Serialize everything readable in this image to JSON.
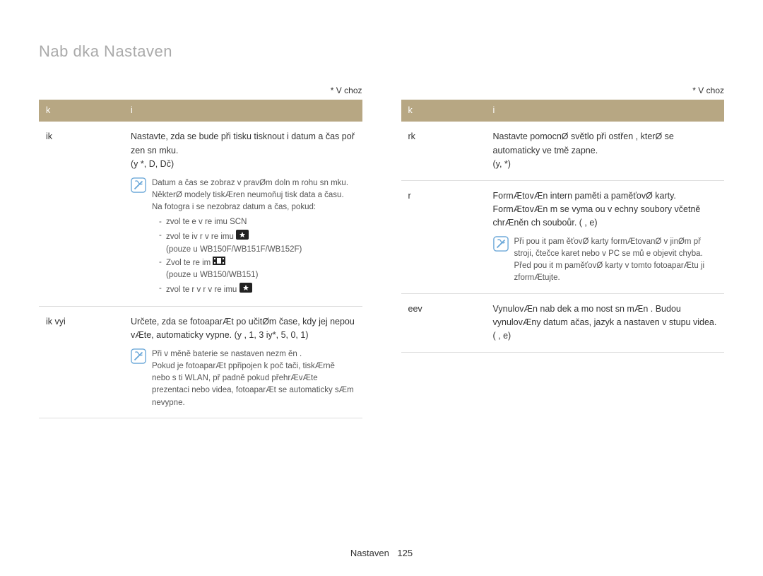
{
  "title": "Nab dka Nastaven",
  "default_marker": "* V choz",
  "footer": {
    "label": "Nastaven",
    "page": "125"
  },
  "icons": {
    "note_alt": "note-icon"
  },
  "left": {
    "header": {
      "k": "k",
      "i": "i"
    },
    "rows": [
      {
        "key": "ik",
        "desc_lines": [
          "Nastavte, zda se bude při tisku tisknout i datum a čas poř zen  sn mku.",
          "(y          *, D, Dč)"
        ],
        "note_lines": [
          "Datum a čas se zobraz  v pravØm doln m rohu sn mku.",
          "NěkterØ modely tiskÆren neumoňuj  tisk data a času.",
          "Na fotogra i se nezobraz  datum a čas, pokud:"
        ],
        "note_bullets": [
          {
            "text": "zvol te e       v re imu SCN",
            "glyph": null
          },
          {
            "text": "zvol te iv r  v re imu",
            "glyph": "star-camera",
            "sub": "(pouze u WB150F/WB151F/WB152F)"
          },
          {
            "text": "Zvol te re im",
            "glyph": "film",
            "sub": "(pouze u WB150/WB151)"
          },
          {
            "text": "zvol te r v r  v re imu",
            "glyph": "star-camera"
          }
        ]
      },
      {
        "key": "ik vyi",
        "desc_lines": [
          "Určete, zda se fotoaparÆt po učitØm čase, kdy jej nepou  vÆte, automaticky vypne. (y          , 1, 3 iy*, 5, 0, 1)"
        ],
        "note_lines": [
          "Při v měně baterie se nastaven  nezm ěn .",
          "Pokud je fotoaparÆt ppřipojen k poč tači, tiskÆrně nebo s ti WLAN, př padně pokud přehrÆvÆte prezentaci nebo videa, fotoaparÆt se automaticky sÆm nevypne."
        ]
      }
    ]
  },
  "right": {
    "header": {
      "k": "k",
      "i": "i"
    },
    "rows": [
      {
        "key": "rk",
        "desc_lines": [
          "Nastavte pomocnØ světlo při ostřen , kterØ se automaticky ve tmě zapne.",
          "(y,                  *)"
        ]
      },
      {
        "key": "r",
        "desc_lines": [
          "FormÆtovÆn  intern  paměti a paměťovØ karty. FormÆtovÆn m se vyma ou v echny soubory včetně chrÆněn ch souboůr. ( , e)"
        ],
        "note_lines": [
          "Při pou it  pam ěťovØ karty formÆtovanØ v jinØm př stroji, čtečce karet nebo v PC se mů e objevit chyba. Před pou it m paměťovØ karty v tomto fotoaparÆtu ji zformÆtujte."
        ]
      },
      {
        "key": "eev",
        "desc_lines": [
          "VynulovÆn  nab dek a mo nost  sn mÆn . Budou vynulovÆny datum ačas, jazyk a nastaven  v stupu videa. ( , e)"
        ]
      }
    ]
  }
}
